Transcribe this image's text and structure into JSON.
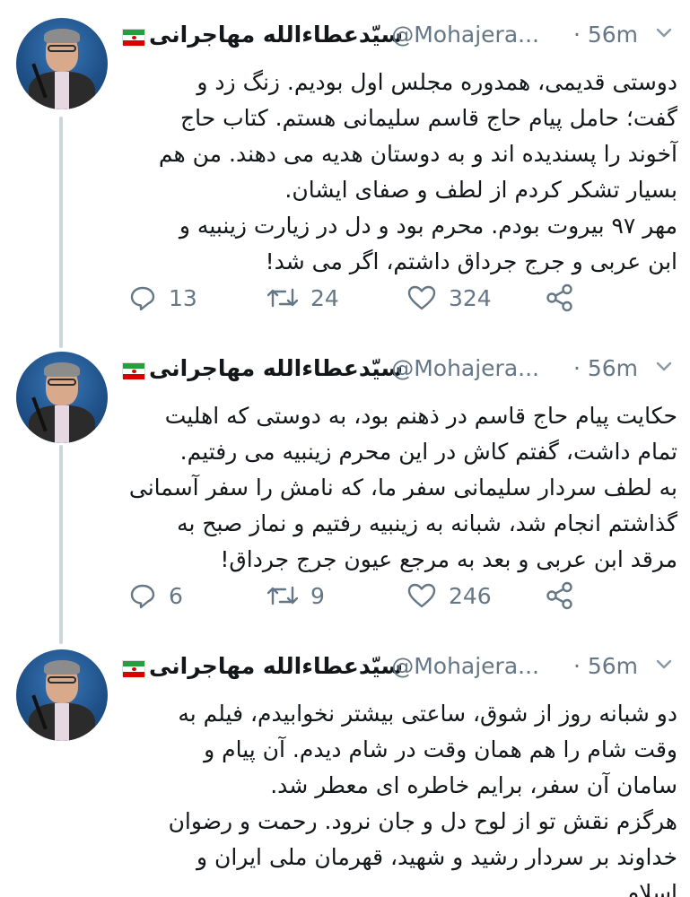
{
  "author": {
    "name": "سیّدعطاءالله مهاجرانی",
    "handle": "@Mohajera...",
    "avatar_icon": "profile-photo",
    "flag_icon": "iran-flag-icon"
  },
  "tweets": [
    {
      "time": "· 56m",
      "text": "دوستی قدیمی، همدوره مجلس اول بودیم. زنگ زد و\nگفت؛ حامل پیام حاج قاسم سلیمانی هستم. کتاب حاج\nآخوند را پسندیده اند و به دوستان هدیه می دهند. من هم\nبسیار تشکر کردم از لطف و صفای ایشان.\nمهر ۹۷ بیروت بودم. محرم بود و دل در زیارت زینبیه و\nابن عربی و جرج جرداق داشتم، اگر می شد!",
      "replies": "13",
      "retweets": "24",
      "likes": "324"
    },
    {
      "time": "· 56m",
      "text": "حکایت پیام حاج قاسم در ذهنم بود، به دوستی که اهلیت\nتمام داشت، گفتم کاش در این محرم زینبیه می رفتیم.\nبه لطف سردار سلیمانی سفر ما، که نامش را سفر آسمانی\nگذاشتم انجام شد، شبانه به زینبیه رفتیم و نماز صبح به\nمرقد ابن عربی و بعد به مرجع عیون جرج جرداق!",
      "replies": "6",
      "retweets": "9",
      "likes": "246"
    },
    {
      "time": "· 56m",
      "text": "دو شبانه روز از شوق، ساعتی بیشتر نخوابیدم، فیلم به\nوقت شام را هم همان وقت در شام دیدم. آن پیام و\nسامان آن سفر، برایم خاطره ای معطر شد.\nهرگزم نقش تو از لوح دل و جان نرود. رحمت و رضوان\nخداوند بر سردار رشید و شهید، قهرمان ملی ایران و\nاسلام"
    }
  ],
  "colors": {
    "text": "#14171a",
    "muted": "#657786",
    "thread_line": "#ccd6dd"
  }
}
